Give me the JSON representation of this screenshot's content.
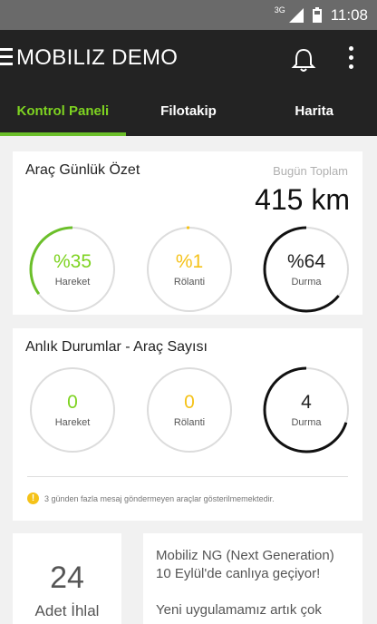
{
  "status": {
    "network": "3G",
    "time": "11:08"
  },
  "app": {
    "title": "MOBILIZ DEMO"
  },
  "tabs": [
    {
      "label": "Kontrol Paneli"
    },
    {
      "label": "Filotakip"
    },
    {
      "label": "Harita"
    }
  ],
  "daily": {
    "title": "Araç Günlük Özet",
    "total_label": "Bugün Toplam",
    "total_value": "415 km",
    "stats": [
      {
        "value": "%35",
        "label": "Hareket",
        "percent": 35,
        "color": "#7ed321",
        "arc_color": "#6bbf2a"
      },
      {
        "value": "%1",
        "label": "Rölanti",
        "percent": 1,
        "color": "#f5c218",
        "arc_color": "#f5c218"
      },
      {
        "value": "%64",
        "label": "Durma",
        "percent": 64,
        "color": "#222222",
        "arc_color": "#111111"
      }
    ]
  },
  "instant": {
    "title": "Anlık Durumlar - Araç Sayısı",
    "stats": [
      {
        "value": "0",
        "label": "Hareket",
        "percent": 0,
        "color": "#7ed321",
        "arc_color": "#6bbf2a"
      },
      {
        "value": "0",
        "label": "Rölanti",
        "percent": 0,
        "color": "#f5c218",
        "arc_color": "#f5c218"
      },
      {
        "value": "4",
        "label": "Durma",
        "percent": 70,
        "color": "#222222",
        "arc_color": "#111111"
      }
    ],
    "warning": "3 günden fazla mesaj göndermeyen araçlar gösterilmemektedir."
  },
  "violations": {
    "count": "24",
    "label": "Adet İhlal"
  },
  "news": {
    "line1": "Mobiliz NG (Next Generation)",
    "line2": "10 Eylül'de canlıya geçiyor!",
    "line3": "Yeni uygulamamız artık çok"
  }
}
